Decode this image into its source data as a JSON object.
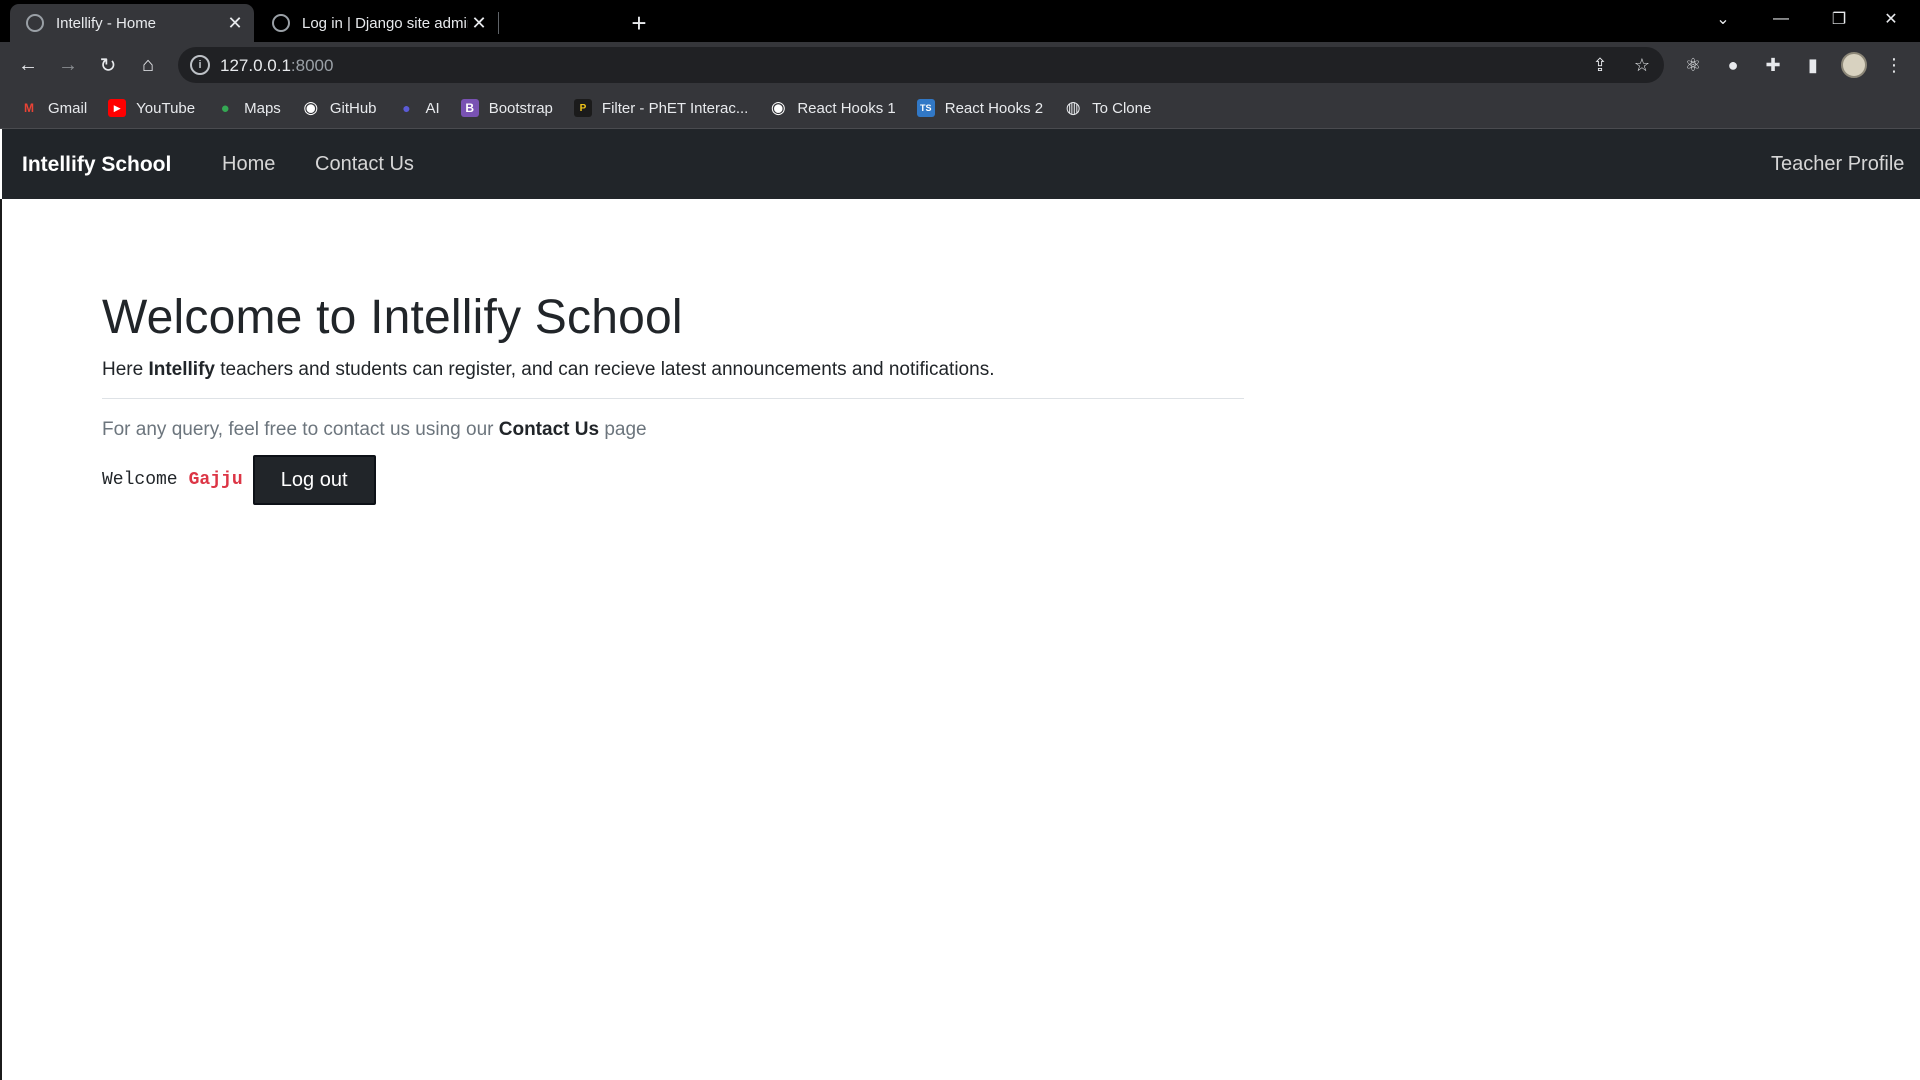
{
  "browser": {
    "tabs": [
      {
        "title": "Intellify - Home",
        "icon": "globe-icon"
      },
      {
        "title": "Log in | Django site admin",
        "icon": "globe-icon"
      }
    ],
    "close_glyph": "✕",
    "new_tab_glyph": "+",
    "window_controls": {
      "tab_search": "⌄",
      "minimize": "—",
      "restore": "❐",
      "close": "✕"
    },
    "nav": {
      "back": "←",
      "forward": "→",
      "reload": "↻",
      "home": "⌂"
    },
    "address": {
      "host": "127.0.0.1",
      "port": ":8000"
    },
    "omnibox_icons": {
      "info": "i",
      "share": "⇪",
      "bookmark_star": "☆"
    },
    "extensions": {
      "react": "⚛",
      "profile_ext": "●",
      "puzzle": "✚",
      "side_panel": "▮",
      "menu": "⋮"
    },
    "bookmarks": [
      {
        "label": "Gmail",
        "icon": "gmail-icon",
        "glyph": "M",
        "color": "#ea4335"
      },
      {
        "label": "YouTube",
        "icon": "youtube-icon",
        "glyph": "▶",
        "color": "#ff0000"
      },
      {
        "label": "Maps",
        "icon": "maps-icon",
        "glyph": "●",
        "color": "#34a853"
      },
      {
        "label": "GitHub",
        "icon": "github-icon",
        "glyph": "◉",
        "color": "#3a3b3f"
      },
      {
        "label": "AI",
        "icon": "ai-icon",
        "glyph": "●",
        "color": "#5b5bd6"
      },
      {
        "label": "Bootstrap",
        "icon": "bootstrap-icon",
        "glyph": "B",
        "color": "#7952b3"
      },
      {
        "label": "Filter - PhET Interac...",
        "icon": "phet-icon",
        "glyph": "P",
        "color": "#1b1b1b"
      },
      {
        "label": "React Hooks 1",
        "icon": "github-icon",
        "glyph": "◉",
        "color": "#3a3b3f"
      },
      {
        "label": "React Hooks 2",
        "icon": "typescript-icon",
        "glyph": "TS",
        "color": "#3178c6"
      },
      {
        "label": "To Clone",
        "icon": "globe-icon",
        "glyph": "◍",
        "color": "#5f6368"
      }
    ]
  },
  "site": {
    "brand": "Intellify School",
    "nav": {
      "home": "Home",
      "contact": "Contact Us",
      "profile": "Teacher Profile"
    }
  },
  "hero": {
    "title": "Welcome to Intellify School",
    "lead_prefix": "Here ",
    "lead_bold": "Intellify",
    "lead_suffix": " teachers and students can register, and can recieve latest announcements and notifications.",
    "query_prefix": "For any query, feel free to contact us using our ",
    "query_bold": "Contact Us",
    "query_suffix": " page"
  },
  "user": {
    "welcome": "Welcome",
    "name": "Gajju",
    "logout": "Log out"
  }
}
